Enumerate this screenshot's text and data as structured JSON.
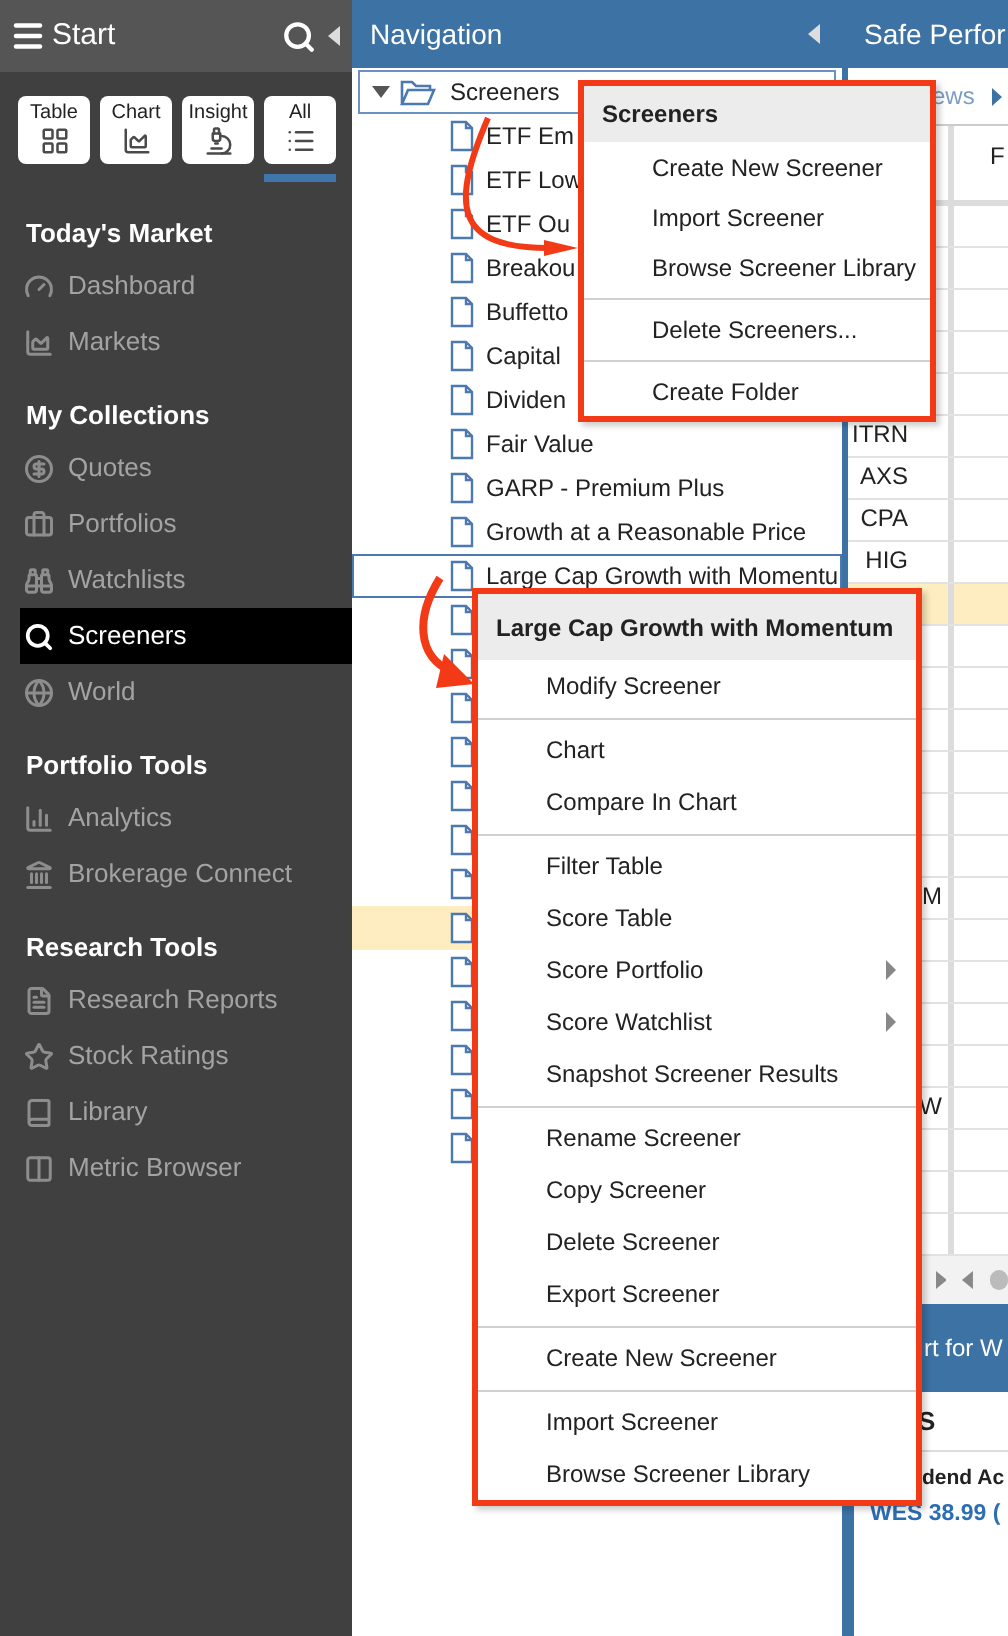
{
  "sidebar": {
    "title": "Start",
    "view_buttons": [
      {
        "label": "Table",
        "selected": false
      },
      {
        "label": "Chart",
        "selected": false
      },
      {
        "label": "Insight",
        "selected": false
      },
      {
        "label": "All",
        "selected": true
      }
    ],
    "sections": [
      {
        "heading": "Today's Market",
        "items": [
          {
            "label": "Dashboard",
            "selected": false
          },
          {
            "label": "Markets",
            "selected": false
          }
        ]
      },
      {
        "heading": "My Collections",
        "items": [
          {
            "label": "Quotes",
            "selected": false
          },
          {
            "label": "Portfolios",
            "selected": false
          },
          {
            "label": "Watchlists",
            "selected": false
          },
          {
            "label": "Screeners",
            "selected": true
          },
          {
            "label": "World",
            "selected": false
          }
        ]
      },
      {
        "heading": "Portfolio Tools",
        "items": [
          {
            "label": "Analytics",
            "selected": false
          },
          {
            "label": "Brokerage Connect",
            "selected": false
          }
        ]
      },
      {
        "heading": "Research Tools",
        "items": [
          {
            "label": "Research Reports",
            "selected": false
          },
          {
            "label": "Stock Ratings",
            "selected": false
          },
          {
            "label": "Library",
            "selected": false
          },
          {
            "label": "Metric Browser",
            "selected": false
          }
        ]
      }
    ]
  },
  "navigation": {
    "title": "Navigation",
    "tree": {
      "label": "Screeners",
      "expanded": true,
      "children": [
        {
          "label": "ETF Em",
          "selected": false,
          "highlighted": false
        },
        {
          "label": "ETF Low",
          "selected": false,
          "highlighted": false
        },
        {
          "label": "ETF Ou",
          "selected": false,
          "highlighted": false
        },
        {
          "label": "Breakou",
          "selected": false,
          "highlighted": false
        },
        {
          "label": "Buffetto",
          "selected": false,
          "highlighted": false
        },
        {
          "label": "Capital",
          "selected": false,
          "highlighted": false
        },
        {
          "label": "Dividen",
          "selected": false,
          "highlighted": false
        },
        {
          "label": "Fair Value",
          "selected": false,
          "highlighted": false
        },
        {
          "label": "GARP - Premium Plus",
          "selected": false,
          "highlighted": false
        },
        {
          "label": "Growth at a Reasonable Price",
          "selected": false,
          "highlighted": false
        },
        {
          "label": "Large Cap Growth with Momentu",
          "selected": true,
          "highlighted": false
        },
        {
          "selected": false,
          "highlighted": false
        },
        {
          "selected": false,
          "highlighted": false
        },
        {
          "selected": false,
          "highlighted": false
        },
        {
          "selected": false,
          "highlighted": false
        },
        {
          "selected": false,
          "highlighted": false
        },
        {
          "selected": false,
          "highlighted": false
        },
        {
          "selected": false,
          "highlighted": false
        },
        {
          "selected": false,
          "highlighted": true
        },
        {
          "selected": false,
          "highlighted": false
        },
        {
          "selected": false,
          "highlighted": false
        },
        {
          "selected": false,
          "highlighted": false
        },
        {
          "selected": false,
          "highlighted": false
        },
        {
          "selected": false,
          "highlighted": false
        }
      ]
    }
  },
  "main_panel": {
    "title": "Safe Perfor",
    "toolbar_link": "ews",
    "table": {
      "column_2_header": "F",
      "rows": [
        {
          "highlighted": false
        },
        {
          "highlighted": false
        },
        {
          "highlighted": false
        },
        {
          "highlighted": false
        },
        {
          "highlighted": false
        },
        {
          "ticker": "ITRN",
          "highlighted": false
        },
        {
          "ticker": "AXS",
          "highlighted": false
        },
        {
          "ticker": "CPA",
          "highlighted": false
        },
        {
          "ticker": "HIG",
          "highlighted": false
        },
        {
          "highlighted": true
        },
        {
          "highlighted": false
        },
        {
          "highlighted": false
        },
        {
          "highlighted": false
        },
        {
          "highlighted": false
        },
        {
          "highlighted": false
        },
        {
          "highlighted": false
        },
        {
          "ticker": "M",
          "highlighted": false
        },
        {
          "highlighted": false
        },
        {
          "highlighted": false
        },
        {
          "highlighted": false
        },
        {
          "highlighted": false
        },
        {
          "ticker": "W",
          "highlighted": false
        },
        {
          "highlighted": false
        },
        {
          "highlighted": false
        },
        {
          "highlighted": false
        }
      ]
    }
  },
  "chart_panel": {
    "title": "rt for W",
    "subtitle": "S",
    "heading": "dend Ac",
    "quote_link": "WES 38.99 ("
  },
  "menus": [
    {
      "title": "Screeners",
      "groups": [
        [
          {
            "label": "Create New Screener"
          },
          {
            "label": "Import Screener"
          },
          {
            "label": "Browse Screener Library"
          }
        ],
        [
          {
            "label": "Delete Screeners..."
          }
        ],
        [
          {
            "label": "Create Folder"
          }
        ]
      ]
    },
    {
      "title": "Large Cap Growth with Momentum",
      "groups": [
        [
          {
            "label": "Modify Screener",
            "submenu": false
          }
        ],
        [
          {
            "label": "Chart",
            "submenu": false
          },
          {
            "label": "Compare In Chart",
            "submenu": false
          }
        ],
        [
          {
            "label": "Filter Table",
            "submenu": false
          },
          {
            "label": "Score Table",
            "submenu": false
          },
          {
            "label": "Score Portfolio",
            "submenu": true
          },
          {
            "label": "Score Watchlist",
            "submenu": true
          },
          {
            "label": "Snapshot Screener Results",
            "submenu": false
          }
        ],
        [
          {
            "label": "Rename Screener",
            "submenu": false
          },
          {
            "label": "Copy Screener",
            "submenu": false
          },
          {
            "label": "Delete Screener",
            "submenu": false
          },
          {
            "label": "Export Screener",
            "submenu": false
          }
        ],
        [
          {
            "label": "Create New Screener",
            "submenu": false
          }
        ],
        [
          {
            "label": "Import Screener",
            "submenu": false
          },
          {
            "label": "Browse Screener Library",
            "submenu": false
          }
        ]
      ]
    }
  ]
}
